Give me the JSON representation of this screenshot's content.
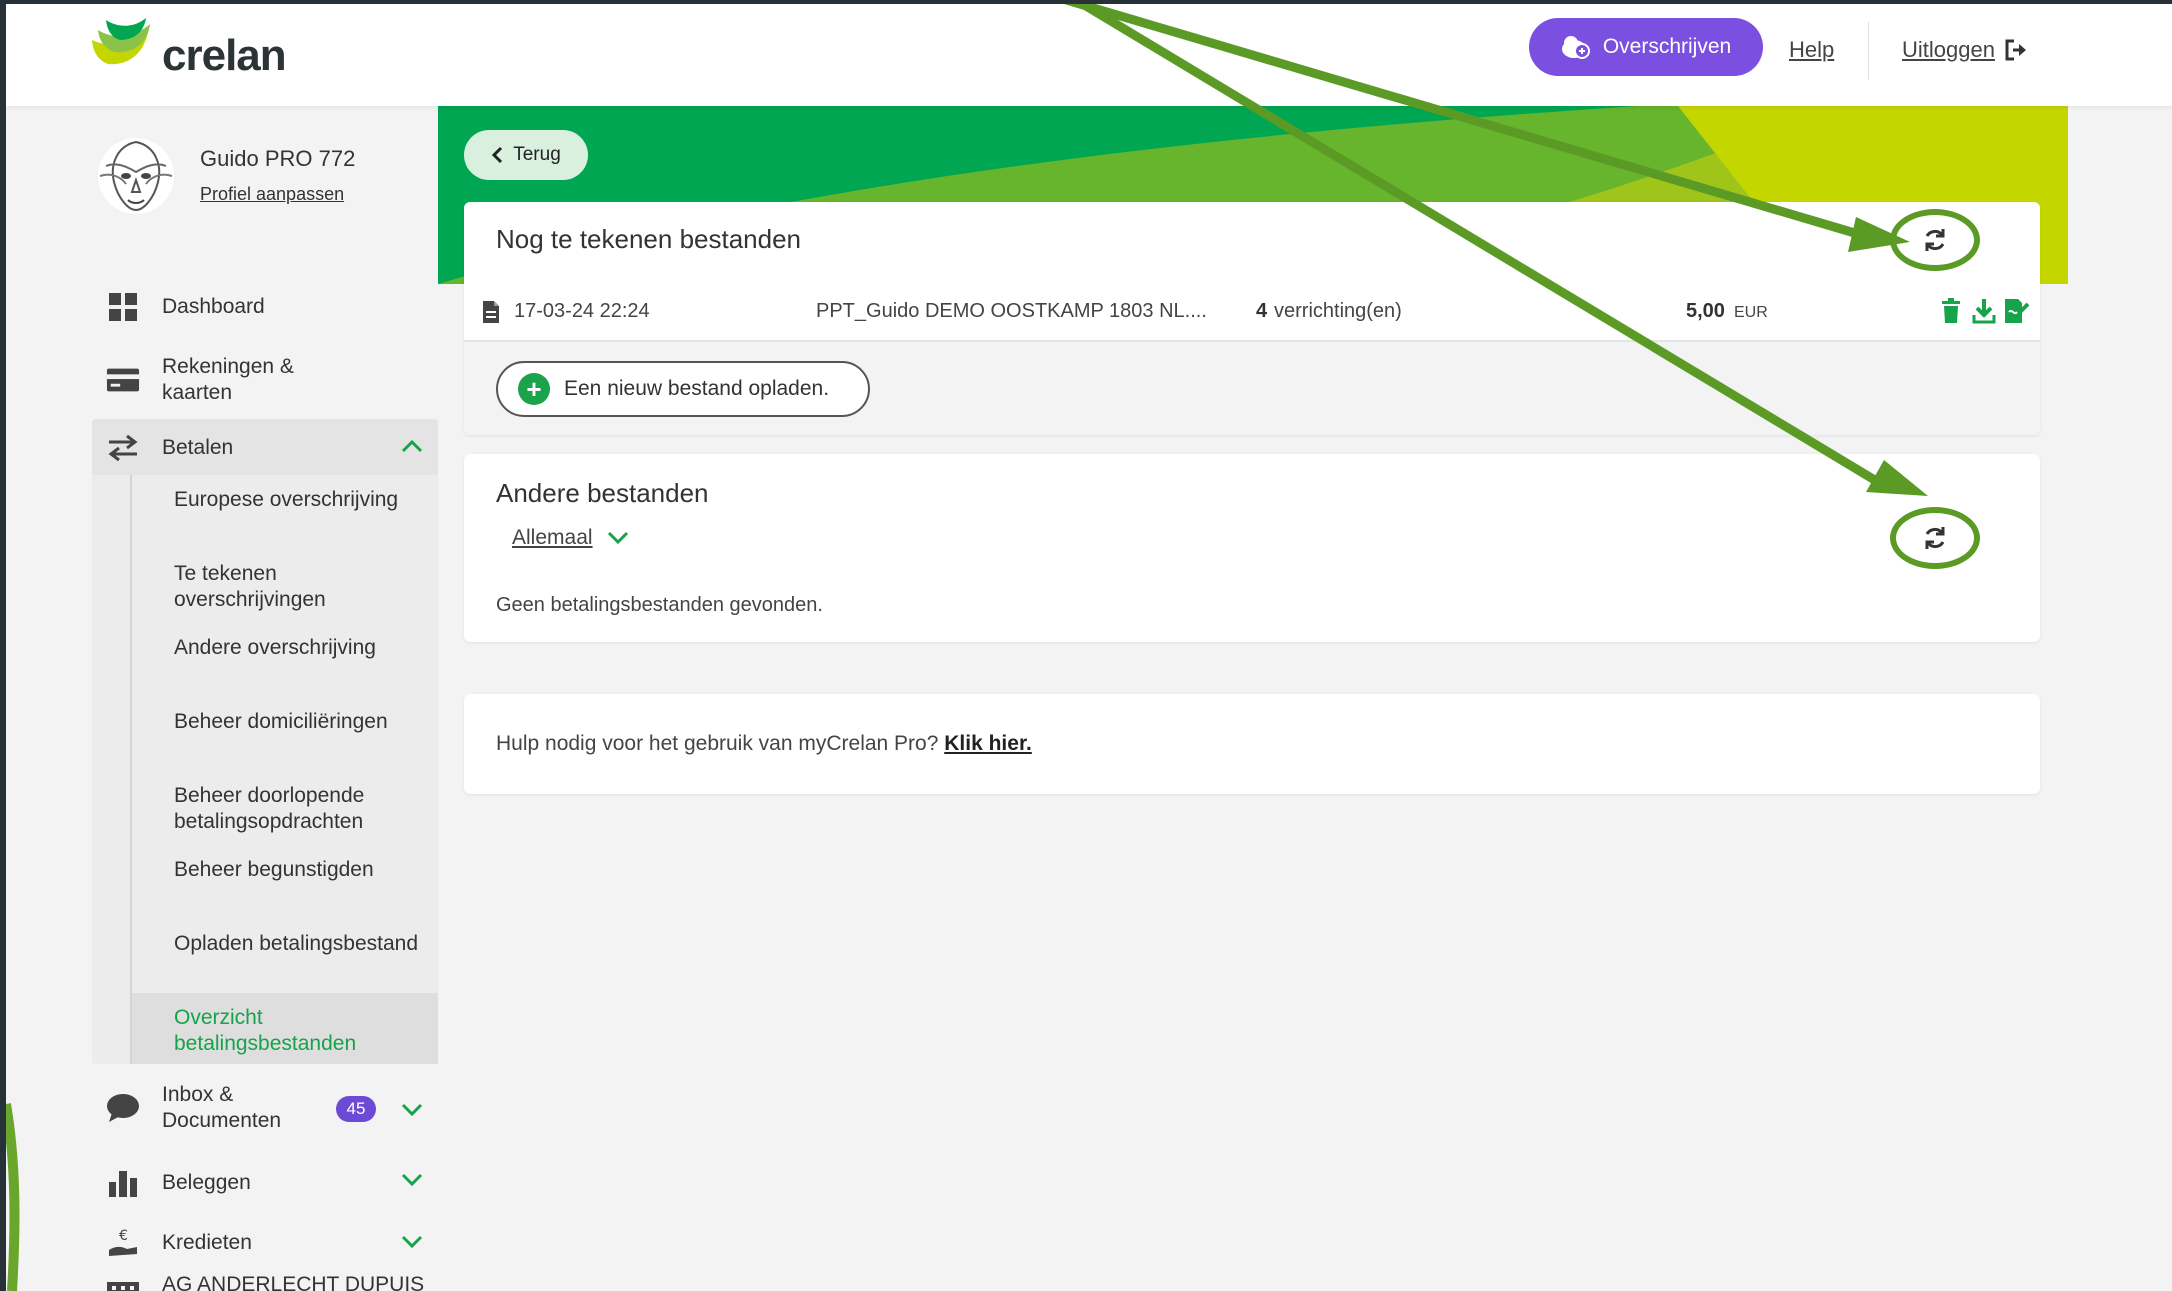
{
  "header": {
    "brand": "crelan",
    "transfer_label": "Overschrijven",
    "help_label": "Help",
    "logout_label": "Uitloggen"
  },
  "profile": {
    "name": "Guido PRO 772",
    "edit_label": "Profiel aanpassen"
  },
  "nav": {
    "dashboard": "Dashboard",
    "accounts": "Rekeningen &\nkaarten",
    "payments": "Betalen",
    "payments_sub": [
      "Europese overschrijving",
      "Te tekenen overschrijvingen",
      "Andere overschrijving",
      "Beheer domiciliëringen",
      "Beheer doorlopende betalingsopdrachten",
      "Beheer begunstigden",
      "Opladen betalingsbestand",
      "Overzicht betalingsbestanden"
    ],
    "inbox": "Inbox &\nDocumenten",
    "inbox_count": "45",
    "invest": "Beleggen",
    "credits": "Kredieten",
    "company": "AG ANDERLECHT DUPUIS"
  },
  "main": {
    "back_label": "Terug",
    "pending": {
      "title": "Nog te tekenen bestanden",
      "file": {
        "date": "17-03-24 22:24",
        "name": "PPT_Guido DEMO OOSTKAMP 1803 NL....",
        "count": "4",
        "count_suffix": "verrichting(en)",
        "amount": "5,00",
        "currency": "EUR"
      },
      "upload_label": "Een nieuw bestand opladen."
    },
    "other": {
      "title": "Andere bestanden",
      "filter_label": "Allemaal",
      "empty_message": "Geen betalingsbestanden gevonden."
    },
    "help": {
      "text": "Hulp nodig voor het gebruik van myCrelan Pro?",
      "link": "Klik hier."
    }
  },
  "colors": {
    "brand_green": "#00a651",
    "lime": "#c4d600",
    "purple": "#7b4fe0",
    "annotation": "#5a9a25"
  }
}
